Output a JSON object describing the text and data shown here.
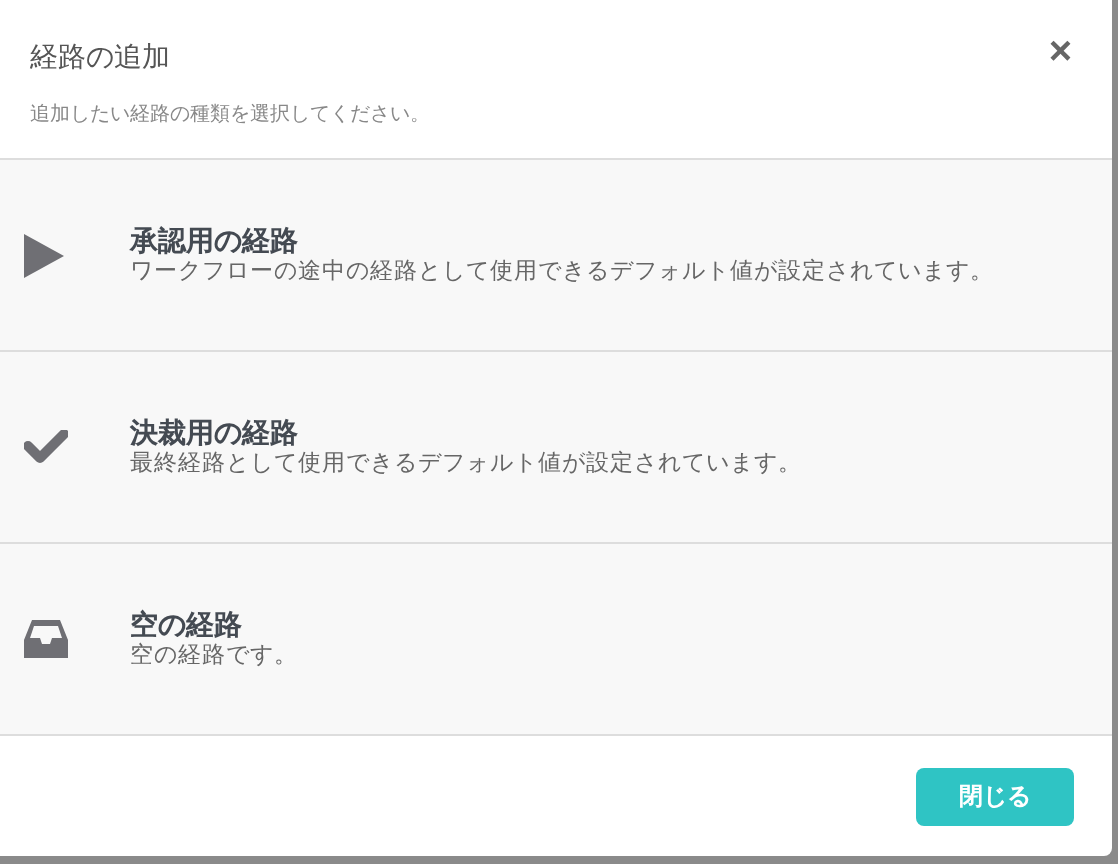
{
  "dialog": {
    "title": "経路の追加",
    "subtitle": "追加したい経路の種類を選択してください。",
    "close_label": "×"
  },
  "options": [
    {
      "kind": "approval",
      "title": "承認用の経路",
      "description": "ワークフローの途中の経路として使用できるデフォルト値が設定されています。"
    },
    {
      "kind": "final",
      "title": "決裁用の経路",
      "description": "最終経路として使用できるデフォルト値が設定されています。"
    },
    {
      "kind": "empty",
      "title": "空の経路",
      "description": "空の経路です。"
    }
  ],
  "footer": {
    "close_button": "閉じる"
  }
}
